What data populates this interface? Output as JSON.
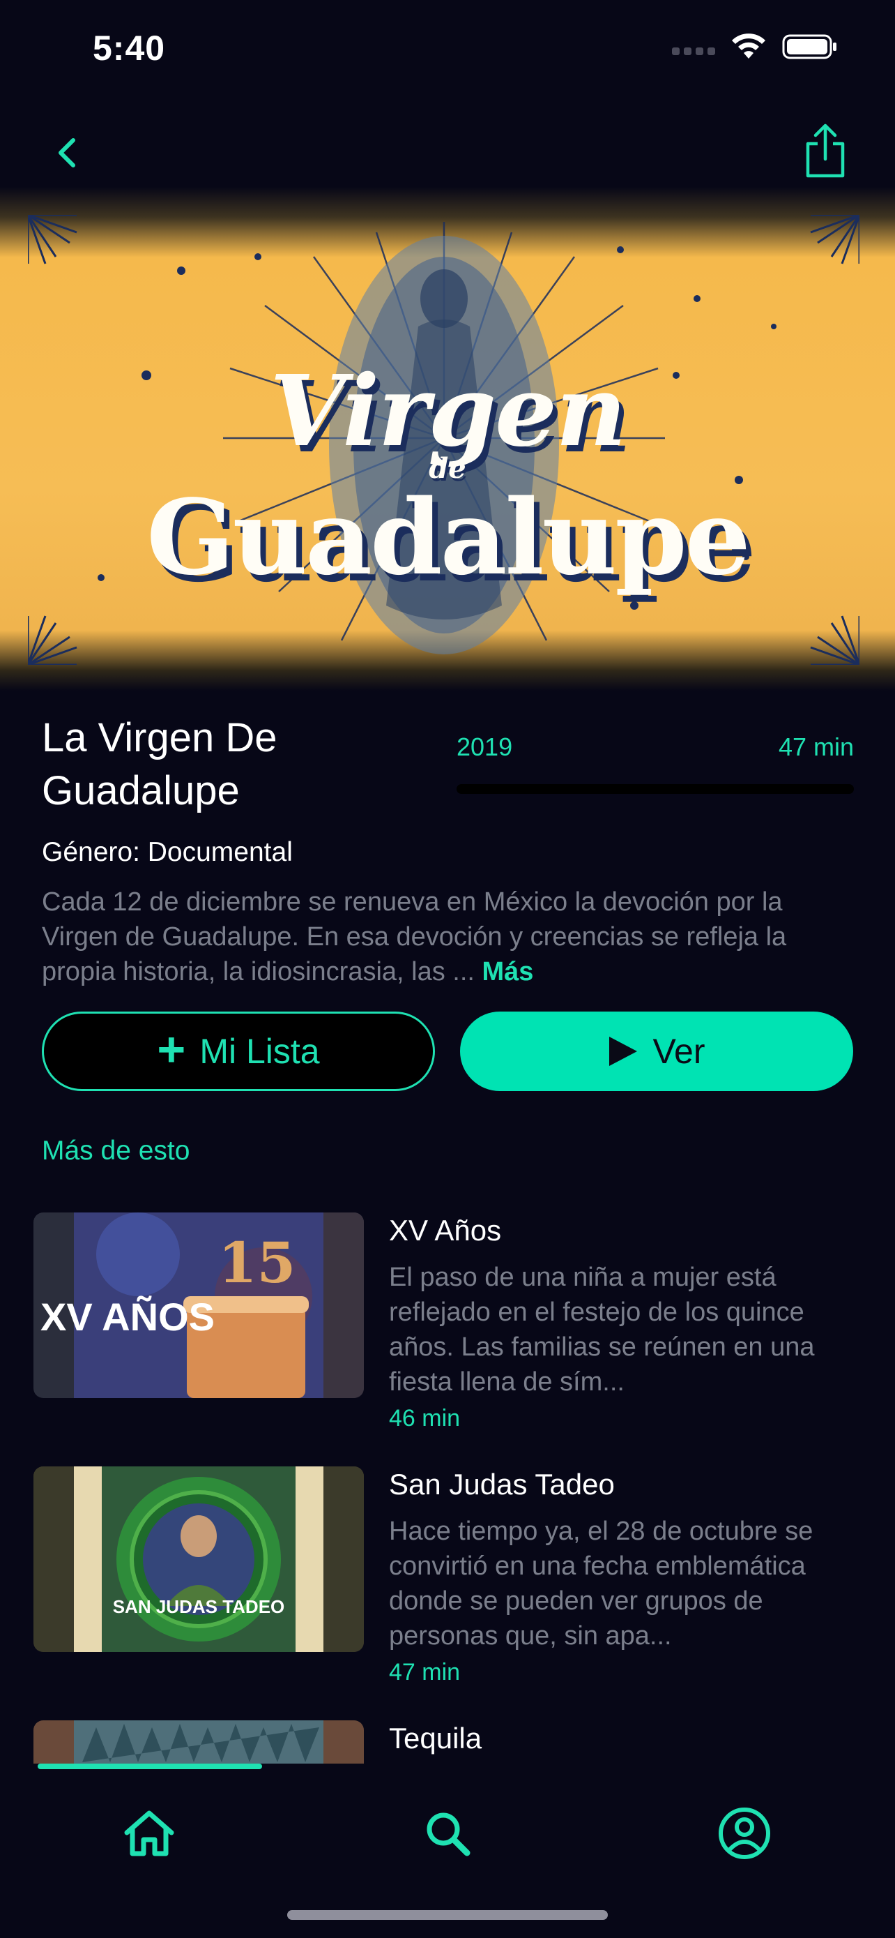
{
  "status_bar": {
    "time": "5:40"
  },
  "nav": {
    "back_icon": "chevron-left-icon",
    "share_icon": "share-icon"
  },
  "hero": {
    "line1": "Virgen",
    "line2": "de",
    "line3": "Guadalupe"
  },
  "detail": {
    "title": "La Virgen De Guadalupe",
    "year": "2019",
    "duration": "47 min",
    "watch_progress": 0,
    "genre_label": "Género:",
    "genre": "Documental",
    "description": "Cada 12 de diciembre se renueva en México la devoción por la Virgen de Guadalupe. En esa devoción y creencias se refleja la propia historia, la idiosincrasia, las ...",
    "more_label": "Más"
  },
  "actions": {
    "list_label": "Mi Lista",
    "play_label": "Ver"
  },
  "related": {
    "title": "Más de esto",
    "items": [
      {
        "title": "XV Años",
        "description": "El paso de una niña a mujer está reflejado en el festejo de los quince años. Las familias se reúnen en una fiesta llena de sím...",
        "duration": "46 min",
        "thumb_text": "XV AÑOS"
      },
      {
        "title": "San Judas Tadeo",
        "description": "Hace tiempo ya, el 28 de octubre se convirtió en una fecha emblemática donde se pueden ver grupos de personas que, sin apa...",
        "duration": "47 min",
        "thumb_text": "SAN JUDAS TADEO"
      },
      {
        "title": "Tequila",
        "description": "",
        "duration": ""
      }
    ]
  },
  "tabbar": {
    "tabs": [
      "home-icon",
      "search-icon",
      "profile-icon"
    ],
    "active": "home-icon"
  },
  "colors": {
    "accent": "#1fe1b2",
    "background": "#070717",
    "hero_gold": "#f6bd55",
    "navy": "#1b2d5c"
  }
}
